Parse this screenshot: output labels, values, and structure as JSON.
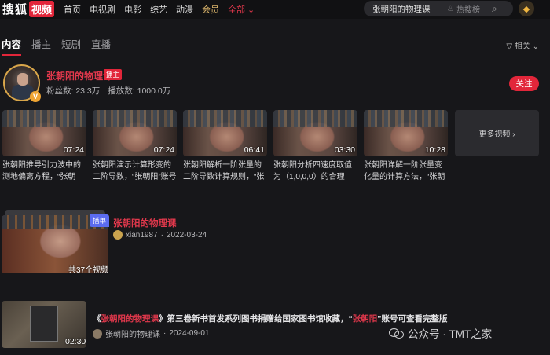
{
  "logo": {
    "part1": "搜狐",
    "part2": "视频"
  },
  "nav": [
    "首页",
    "电视剧",
    "电影",
    "综艺",
    "动漫",
    "会员",
    "全部 ⌄"
  ],
  "search": {
    "query": "张朝阳的物理课",
    "hot_label": "热搜榜"
  },
  "tabs": [
    "内容",
    "播主",
    "短剧",
    "直播"
  ],
  "sort_label": "▽ 相关 ⌄",
  "channel": {
    "name": "张朝阳的物理课",
    "tag": "播主",
    "verify": "V",
    "fans": "粉丝数: 23.3万",
    "plays": "播放数: 1000.0万",
    "follow_label": "关注"
  },
  "videos": [
    {
      "duration": "07:24",
      "title": "张朝阳推导引力波中的测地偏离方程，“张朝阳”…"
    },
    {
      "duration": "07:24",
      "title": "张朝阳演示计算形变的二阶导数，“张朝阳”账号可查…"
    },
    {
      "duration": "06:41",
      "title": "张朝阳解析一阶张量的二阶导数计算规则，“张朝阳”…"
    },
    {
      "duration": "03:30",
      "title": "张朝阳分析四速度取值为（1,0,0,0）的合理性，“张…"
    },
    {
      "duration": "10:28",
      "title": "张朝阳详解一阶张量变化量的计算方法，“张朝阳”账…"
    }
  ],
  "more_videos_label": "更多视频 ›",
  "playlist": {
    "tag": "播单",
    "count": "共37个视频",
    "title": "张朝阳的物理课",
    "author": "xian1987",
    "date": "2022-03-24"
  },
  "news": {
    "duration": "02:30",
    "title_pre": "《",
    "title_hl1": "张朝阳的物理课",
    "title_mid": "》第三卷新书首发系列图书捐赠给国家图书馆收藏，“",
    "title_hl2": "张朝阳",
    "title_post": "”账号可查看完整版",
    "author": "张朝阳的物理课",
    "date": "2024-09-01"
  },
  "watermark": "公众号 · TMT之家"
}
